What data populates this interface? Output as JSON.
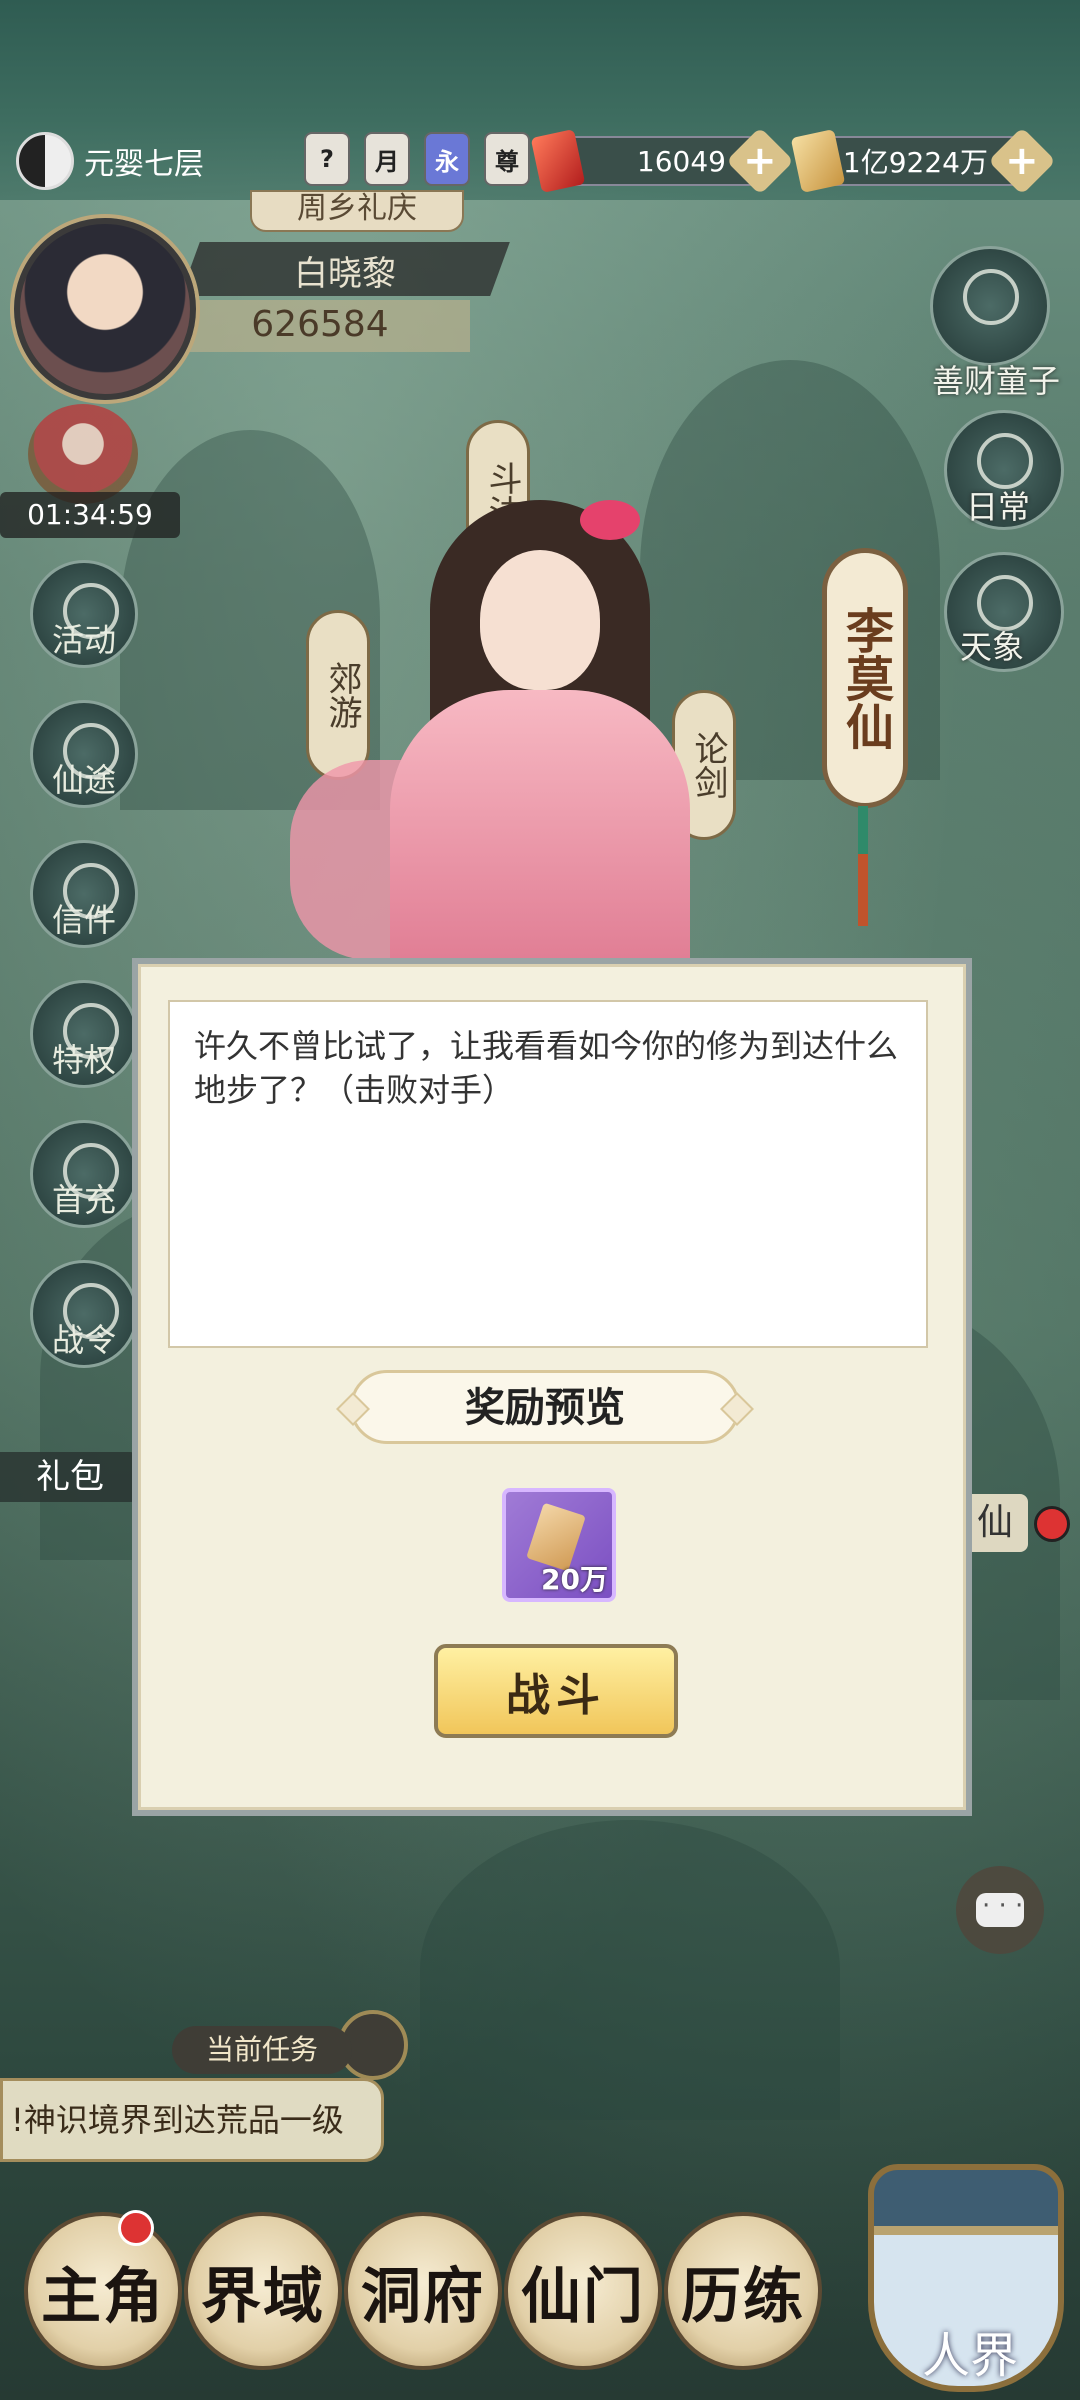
{
  "status_bar": {
    "realm_text": "元婴七层",
    "badges": [
      "?",
      "月",
      "永",
      "尊"
    ],
    "resources": [
      {
        "name": "red-gem",
        "value": "16049"
      },
      {
        "name": "gold-ticket",
        "value": "1亿9224万"
      }
    ],
    "plus": "+"
  },
  "player": {
    "event_tag": "周乡礼庆",
    "name": "白晓黎",
    "power": "626584",
    "timer": "01:34:59"
  },
  "left_menu": {
    "items": [
      "活动",
      "仙途",
      "信件",
      "特权",
      "首充",
      "战令"
    ],
    "gift_label": "礼包"
  },
  "right_menu": {
    "items": [
      "善财童子",
      "日常",
      "天象"
    ]
  },
  "map_signs": {
    "sign1": "郊游",
    "sign2": "斗法",
    "sign3": "论剑"
  },
  "npc": {
    "name": "李莫仙"
  },
  "dialog": {
    "text": "许久不曾比试了，让我看看如今你的修为到达什么地步了？（击败对手）",
    "reward_title": "奖励预览",
    "reward_amount": "20万",
    "fight_button": "战斗"
  },
  "partial_label": "仙",
  "task": {
    "label": "当前任务",
    "text": "!神识境界到达荒品一级"
  },
  "bottom_nav": {
    "items": [
      "主角",
      "界域",
      "洞府",
      "仙门",
      "历练"
    ],
    "world": "人界"
  },
  "colors": {
    "accent": "#f1c65a",
    "dialog_bg": "#f3f0de",
    "npc_name": "#6a3d1e"
  }
}
